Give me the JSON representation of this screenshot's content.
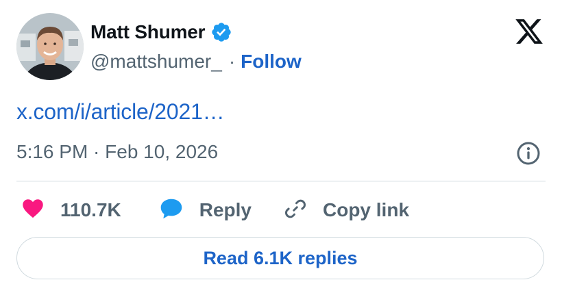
{
  "author": {
    "display_name": "Matt Shumer",
    "handle": "@mattshumer_",
    "separator": "·",
    "follow_label": "Follow",
    "verified": true
  },
  "tweet": {
    "link_text": "x.com/i/article/2021…",
    "timestamp": "5:16 PM · Feb 10, 2026"
  },
  "actions": {
    "likes": "110.7K",
    "reply_label": "Reply",
    "copy_link_label": "Copy link"
  },
  "read_replies_label": "Read 6.1K replies",
  "icons": {
    "brand": "x-logo-icon",
    "verified": "verified-badge-icon",
    "info": "info-icon",
    "like": "heart-icon",
    "reply": "speech-bubble-icon",
    "copy": "link-icon"
  },
  "colors": {
    "link_blue": "#1d64c8",
    "verified_blue": "#1d9bf0",
    "heart_pink": "#f91880",
    "text_dark": "#0f1419",
    "text_gray": "#536471",
    "border": "#cfd9de"
  }
}
